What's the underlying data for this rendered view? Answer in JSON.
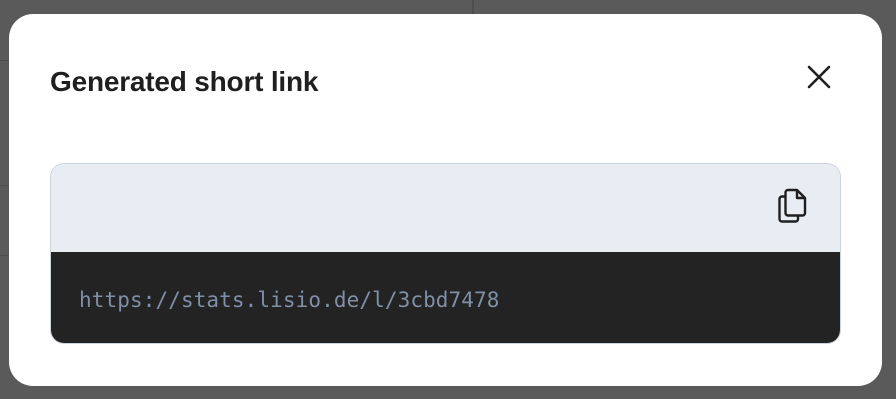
{
  "dialog": {
    "title": "Generated short link",
    "close_icon": "close-icon",
    "copy_icon": "copy-icon",
    "short_link": "https://stats.lisio.de/l/3cbd7478"
  },
  "colors": {
    "backdrop": "#5a5a5a",
    "modal_background": "#ffffff",
    "header_background": "#e8edf4",
    "code_background": "#232323",
    "link_text": "#7f8fa6",
    "title_text": "#1f1f1f"
  }
}
